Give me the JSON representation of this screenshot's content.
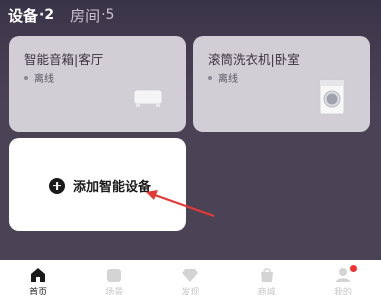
{
  "tabs": [
    {
      "label": "设备",
      "count": "·2",
      "active": true
    },
    {
      "label": "房间",
      "count": "·5",
      "active": false
    }
  ],
  "devices": [
    {
      "name": "智能音箱|客厅",
      "status": "离线",
      "icon": "speaker-icon"
    },
    {
      "name": "滚筒洗衣机|卧室",
      "status": "离线",
      "icon": "washing-machine-icon"
    }
  ],
  "add_card": {
    "label": "添加智能设备",
    "icon": "plus-circle-icon"
  },
  "bottom_nav": [
    {
      "label": "首页",
      "icon": "home-icon",
      "active": true
    },
    {
      "label": "场景",
      "icon": "scene-icon",
      "active": false
    },
    {
      "label": "发现",
      "icon": "diamond-icon",
      "active": false
    },
    {
      "label": "商城",
      "icon": "shopping-bag-icon",
      "active": false
    },
    {
      "label": "我的",
      "icon": "user-icon",
      "active": false,
      "badge": true
    }
  ],
  "colors": {
    "accent_arrow": "#e53935",
    "badge": "#f23030"
  }
}
